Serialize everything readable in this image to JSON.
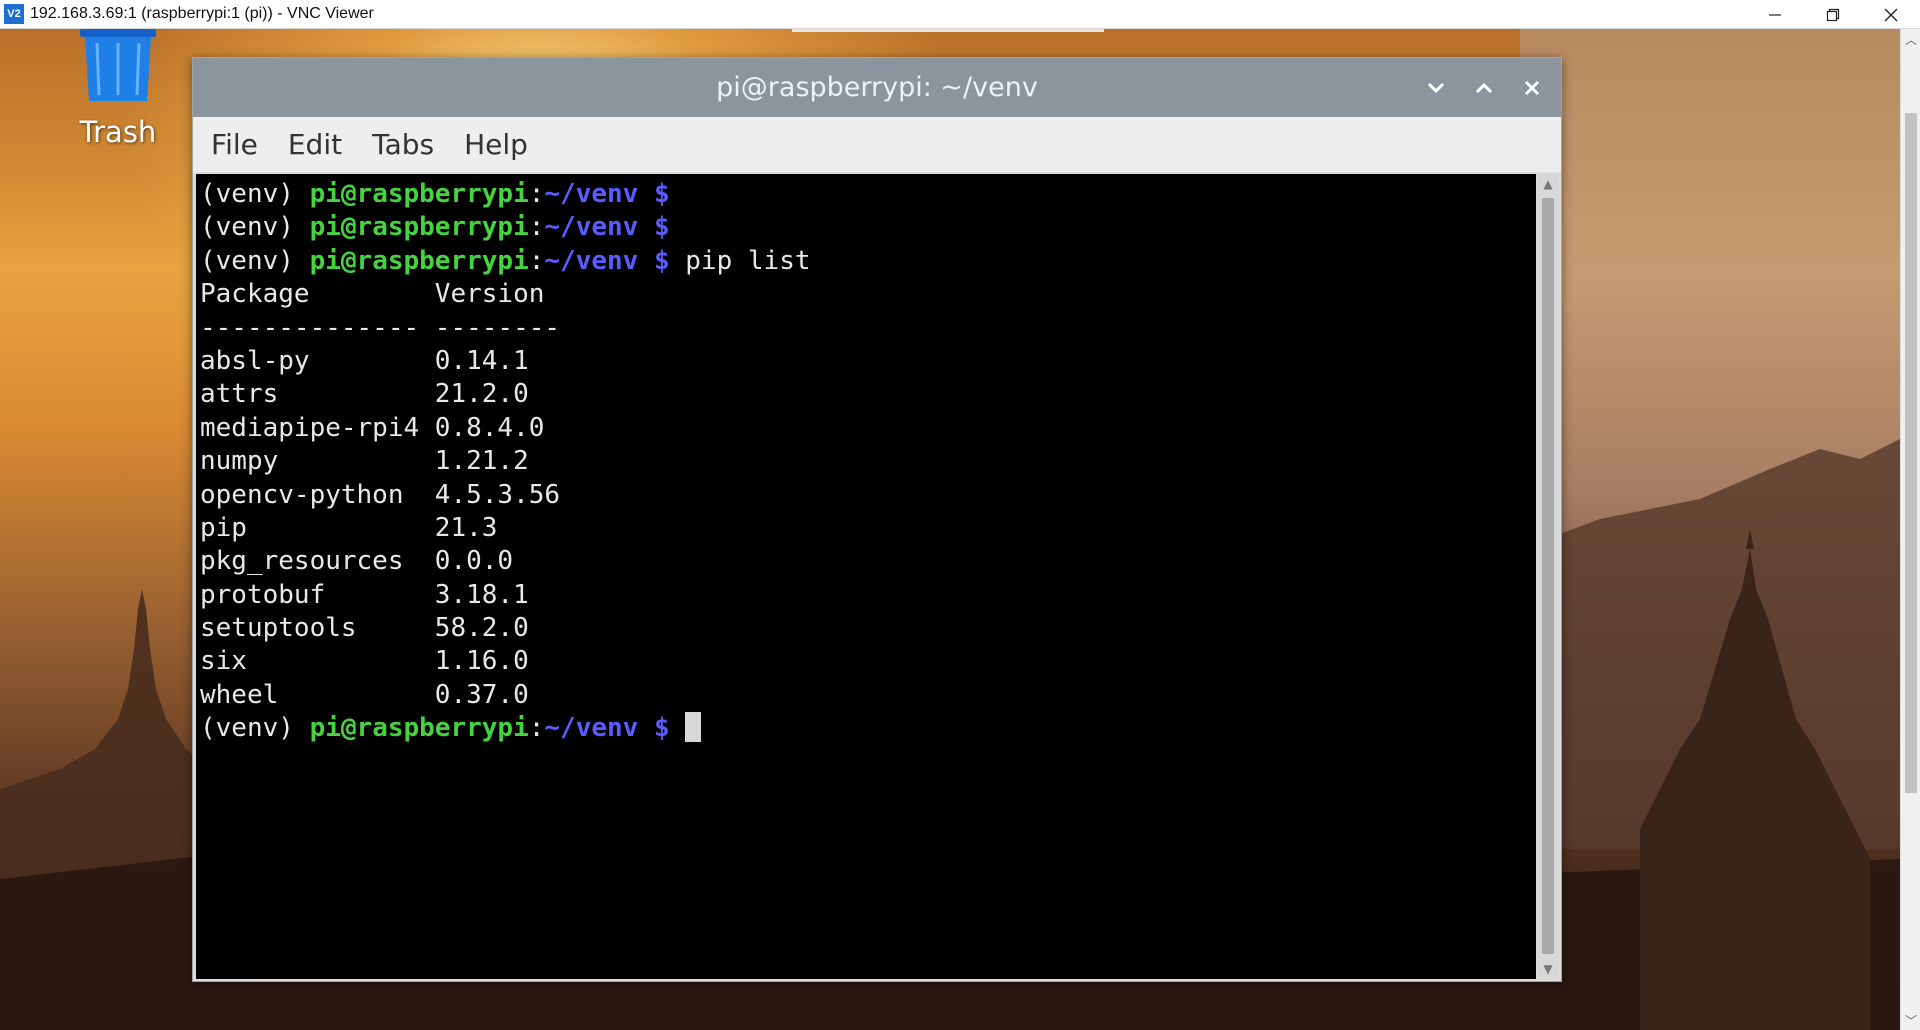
{
  "vnc": {
    "logo_text": "V2",
    "title": "192.168.3.69:1 (raspberrypi:1 (pi)) - VNC Viewer",
    "minimize_icon": "minimize-icon",
    "restore_icon": "restore-icon",
    "close_icon": "close-icon"
  },
  "desktop": {
    "trash_label": "Trash"
  },
  "terminal": {
    "title": "pi@raspberrypi: ~/venv",
    "menu": [
      "File",
      "Edit",
      "Tabs",
      "Help"
    ],
    "prompt": {
      "venv": "(venv) ",
      "user": "pi@raspberrypi",
      "colon": ":",
      "path": "~/venv",
      "dollar": " $"
    },
    "command": " pip list",
    "header": "Package        Version",
    "separator": "-------------- --------",
    "packages": [
      "absl-py        0.14.1",
      "attrs          21.2.0",
      "mediapipe-rpi4 0.8.4.0",
      "numpy          1.21.2",
      "opencv-python  4.5.3.56",
      "pip            21.3",
      "pkg_resources  0.0.0",
      "protobuf       3.18.1",
      "setuptools     58.2.0",
      "six            1.16.0",
      "wheel          0.37.0"
    ]
  },
  "colors": {
    "prompt_user": "#45d33f",
    "prompt_path": "#5a5cff",
    "terminal_bg": "#000000",
    "titlebar": "#8a959d"
  }
}
